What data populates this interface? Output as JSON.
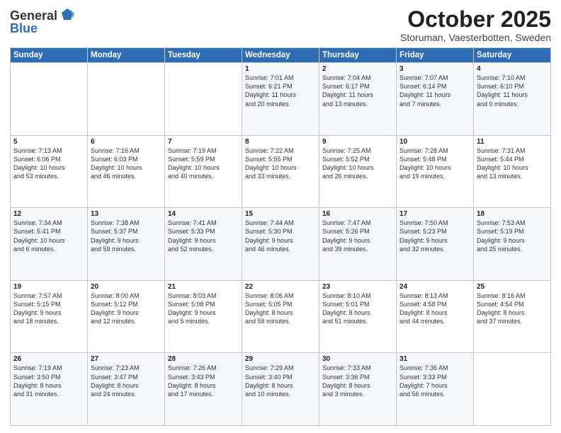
{
  "header": {
    "logo_general": "General",
    "logo_blue": "Blue",
    "title": "October 2025",
    "subtitle": "Storuman, Vaesterbotten, Sweden"
  },
  "weekdays": [
    "Sunday",
    "Monday",
    "Tuesday",
    "Wednesday",
    "Thursday",
    "Friday",
    "Saturday"
  ],
  "weeks": [
    [
      {
        "day": "",
        "text": ""
      },
      {
        "day": "",
        "text": ""
      },
      {
        "day": "",
        "text": ""
      },
      {
        "day": "1",
        "text": "Sunrise: 7:01 AM\nSunset: 6:21 PM\nDaylight: 11 hours\nand 20 minutes."
      },
      {
        "day": "2",
        "text": "Sunrise: 7:04 AM\nSunset: 6:17 PM\nDaylight: 11 hours\nand 13 minutes."
      },
      {
        "day": "3",
        "text": "Sunrise: 7:07 AM\nSunset: 6:14 PM\nDaylight: 11 hours\nand 7 minutes."
      },
      {
        "day": "4",
        "text": "Sunrise: 7:10 AM\nSunset: 6:10 PM\nDaylight: 11 hours\nand 0 minutes."
      }
    ],
    [
      {
        "day": "5",
        "text": "Sunrise: 7:13 AM\nSunset: 6:06 PM\nDaylight: 10 hours\nand 53 minutes."
      },
      {
        "day": "6",
        "text": "Sunrise: 7:16 AM\nSunset: 6:03 PM\nDaylight: 10 hours\nand 46 minutes."
      },
      {
        "day": "7",
        "text": "Sunrise: 7:19 AM\nSunset: 5:59 PM\nDaylight: 10 hours\nand 40 minutes."
      },
      {
        "day": "8",
        "text": "Sunrise: 7:22 AM\nSunset: 5:55 PM\nDaylight: 10 hours\nand 33 minutes."
      },
      {
        "day": "9",
        "text": "Sunrise: 7:25 AM\nSunset: 5:52 PM\nDaylight: 10 hours\nand 26 minutes."
      },
      {
        "day": "10",
        "text": "Sunrise: 7:28 AM\nSunset: 5:48 PM\nDaylight: 10 hours\nand 19 minutes."
      },
      {
        "day": "11",
        "text": "Sunrise: 7:31 AM\nSunset: 5:44 PM\nDaylight: 10 hours\nand 13 minutes."
      }
    ],
    [
      {
        "day": "12",
        "text": "Sunrise: 7:34 AM\nSunset: 5:41 PM\nDaylight: 10 hours\nand 6 minutes."
      },
      {
        "day": "13",
        "text": "Sunrise: 7:38 AM\nSunset: 5:37 PM\nDaylight: 9 hours\nand 59 minutes."
      },
      {
        "day": "14",
        "text": "Sunrise: 7:41 AM\nSunset: 5:33 PM\nDaylight: 9 hours\nand 52 minutes."
      },
      {
        "day": "15",
        "text": "Sunrise: 7:44 AM\nSunset: 5:30 PM\nDaylight: 9 hours\nand 46 minutes."
      },
      {
        "day": "16",
        "text": "Sunrise: 7:47 AM\nSunset: 5:26 PM\nDaylight: 9 hours\nand 39 minutes."
      },
      {
        "day": "17",
        "text": "Sunrise: 7:50 AM\nSunset: 5:23 PM\nDaylight: 9 hours\nand 32 minutes."
      },
      {
        "day": "18",
        "text": "Sunrise: 7:53 AM\nSunset: 5:19 PM\nDaylight: 9 hours\nand 25 minutes."
      }
    ],
    [
      {
        "day": "19",
        "text": "Sunrise: 7:57 AM\nSunset: 5:15 PM\nDaylight: 9 hours\nand 18 minutes."
      },
      {
        "day": "20",
        "text": "Sunrise: 8:00 AM\nSunset: 5:12 PM\nDaylight: 9 hours\nand 12 minutes."
      },
      {
        "day": "21",
        "text": "Sunrise: 8:03 AM\nSunset: 5:08 PM\nDaylight: 9 hours\nand 5 minutes."
      },
      {
        "day": "22",
        "text": "Sunrise: 8:06 AM\nSunset: 5:05 PM\nDaylight: 8 hours\nand 58 minutes."
      },
      {
        "day": "23",
        "text": "Sunrise: 8:10 AM\nSunset: 5:01 PM\nDaylight: 8 hours\nand 51 minutes."
      },
      {
        "day": "24",
        "text": "Sunrise: 8:13 AM\nSunset: 4:58 PM\nDaylight: 8 hours\nand 44 minutes."
      },
      {
        "day": "25",
        "text": "Sunrise: 8:16 AM\nSunset: 4:54 PM\nDaylight: 8 hours\nand 37 minutes."
      }
    ],
    [
      {
        "day": "26",
        "text": "Sunrise: 7:19 AM\nSunset: 3:50 PM\nDaylight: 8 hours\nand 31 minutes."
      },
      {
        "day": "27",
        "text": "Sunrise: 7:23 AM\nSunset: 3:47 PM\nDaylight: 8 hours\nand 24 minutes."
      },
      {
        "day": "28",
        "text": "Sunrise: 7:26 AM\nSunset: 3:43 PM\nDaylight: 8 hours\nand 17 minutes."
      },
      {
        "day": "29",
        "text": "Sunrise: 7:29 AM\nSunset: 3:40 PM\nDaylight: 8 hours\nand 10 minutes."
      },
      {
        "day": "30",
        "text": "Sunrise: 7:33 AM\nSunset: 3:36 PM\nDaylight: 8 hours\nand 3 minutes."
      },
      {
        "day": "31",
        "text": "Sunrise: 7:36 AM\nSunset: 3:33 PM\nDaylight: 7 hours\nand 56 minutes."
      },
      {
        "day": "",
        "text": ""
      }
    ]
  ]
}
